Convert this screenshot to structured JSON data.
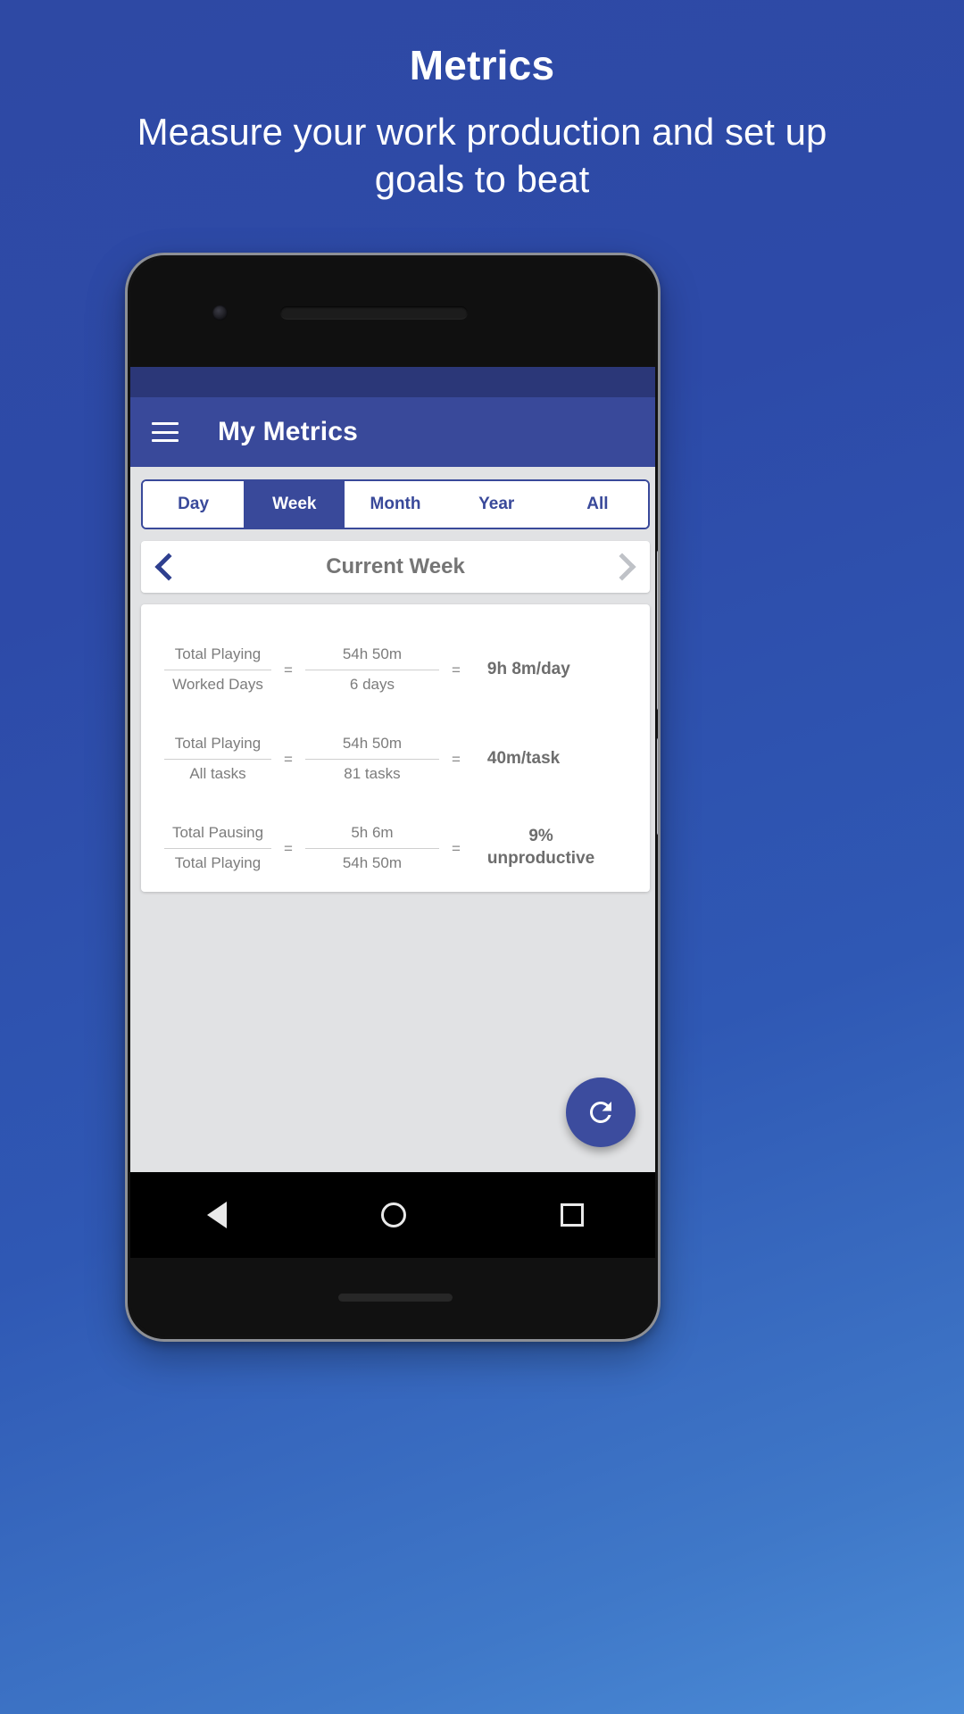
{
  "promo": {
    "title": "Metrics",
    "subtitle": "Measure your work production and set up goals to beat"
  },
  "colors": {
    "brand": "#39499a",
    "status_bar": "#2b3778",
    "fab": "#3c4c9e",
    "screen_bg": "#e1e2e4",
    "muted_text": "#7c7c7c",
    "result_text": "#6d6d6d"
  },
  "app": {
    "menu_icon": "hamburger-icon",
    "title": "My Metrics"
  },
  "tabs": [
    {
      "label": "Day",
      "selected": false
    },
    {
      "label": "Week",
      "selected": true
    },
    {
      "label": "Month",
      "selected": false
    },
    {
      "label": "Year",
      "selected": false
    },
    {
      "label": "All",
      "selected": false
    }
  ],
  "period_nav": {
    "prev_icon": "chevron-left-icon",
    "label": "Current Week",
    "next_icon": "chevron-right-icon"
  },
  "metrics": [
    {
      "left_numerator": "Total Playing",
      "left_denominator": "Worked Days",
      "right_numerator": "54h 50m",
      "right_denominator": "6 days",
      "equals": "=",
      "result": "9h 8m/day"
    },
    {
      "left_numerator": "Total Playing",
      "left_denominator": "All tasks",
      "right_numerator": "54h 50m",
      "right_denominator": "81 tasks",
      "equals": "=",
      "result": "40m/task"
    },
    {
      "left_numerator": "Total Pausing",
      "left_denominator": "Total Playing",
      "right_numerator": "5h 6m",
      "right_denominator": "54h 50m",
      "equals": "=",
      "result": "9%\nunproductive"
    }
  ],
  "fab": {
    "icon": "refresh-icon"
  },
  "navbar": {
    "back": "back-triangle-icon",
    "home": "home-circle-icon",
    "recents": "recents-square-icon"
  }
}
